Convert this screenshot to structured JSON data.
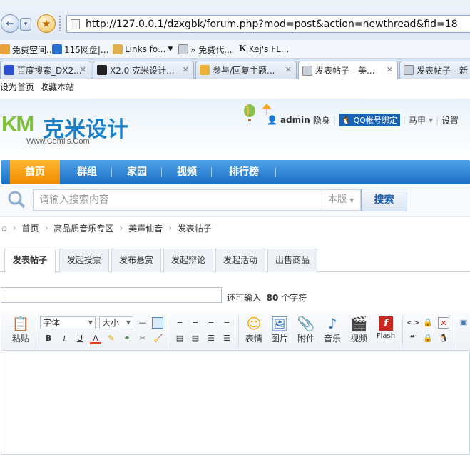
{
  "browser": {
    "url": "http://127.0.0.1/dzxgbk/forum.php?mod=post&action=newthread&fid=18",
    "bookmarks": [
      "免费空间...",
      "115网盘|...",
      "Links fo...",
      "» 免费代...",
      "Kej's FL..."
    ],
    "tabs": [
      {
        "label": "百度搜索_DX2..."
      },
      {
        "label": "X2.0 克米设计..."
      },
      {
        "label": "参与/回复主题..."
      },
      {
        "label": "发表帖子 - 美..."
      },
      {
        "label": "发表帖子 - 新"
      }
    ],
    "active_tab": 3
  },
  "toplinks": {
    "set_home": "设为首页",
    "bookmark_site": "收藏本站"
  },
  "header": {
    "logo_mark": "KM",
    "logo_cn": "克米设计",
    "logo_sub": "Www.Comiis.Com",
    "user": "admin",
    "invisible": "隐身",
    "qq_bind": "QQ帐号绑定",
    "horse": "马甲",
    "settings": "设置"
  },
  "nav": {
    "items": [
      "首页",
      "群组",
      "家园",
      "视频",
      "排行榜"
    ],
    "active": 0
  },
  "search": {
    "placeholder": "请输入搜索内容",
    "scope": "本版",
    "button": "搜索"
  },
  "breadcrumb": [
    "首页",
    "高品质音乐专区",
    "美声仙音",
    "发表帖子"
  ],
  "post_tabs": {
    "items": [
      "发表帖子",
      "发起投票",
      "发布悬赏",
      "发起辩论",
      "发起活动",
      "出售商品"
    ],
    "active": 0
  },
  "title": {
    "value": "",
    "remain_prefix": "还可输入",
    "remain_count": "80",
    "remain_suffix": "个字符"
  },
  "editor": {
    "paste": "粘贴",
    "font": "字体",
    "size": "大小",
    "big_buttons": [
      "表情",
      "图片",
      "附件",
      "音乐",
      "视频",
      "Flash"
    ],
    "small_buttons": {
      "bold": "B",
      "italic": "I",
      "underline": "U",
      "color": "A"
    }
  },
  "colors": {
    "nav_blue": "#1b6fc4",
    "nav_active": "#f08a00",
    "logo_green": "#7fbf3a",
    "logo_blue": "#1a7fc9"
  }
}
